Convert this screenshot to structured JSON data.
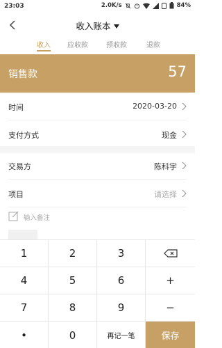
{
  "status_bar": {
    "time": "23:03",
    "speed": "2.0K/s",
    "battery": "84%"
  },
  "header": {
    "title": "收入账本"
  },
  "tabs": [
    {
      "label": "收入",
      "active": true
    },
    {
      "label": "应收款",
      "active": false
    },
    {
      "label": "预收款",
      "active": false
    },
    {
      "label": "退款",
      "active": false
    }
  ],
  "banner": {
    "label": "销售款",
    "amount": "57"
  },
  "fields": {
    "time": {
      "label": "时间",
      "value": "2020-03-20"
    },
    "payment": {
      "label": "支付方式",
      "value": "现金"
    },
    "counterparty": {
      "label": "交易方",
      "value": "陈科宇"
    },
    "project": {
      "label": "项目",
      "placeholder": "请选择"
    }
  },
  "note": {
    "placeholder": "输入备注"
  },
  "keypad": {
    "keys": [
      "1",
      "2",
      "3",
      "4",
      "5",
      "6",
      "+",
      "7",
      "8",
      "9",
      "−",
      "•",
      "0"
    ],
    "remember_label": "再记一笔",
    "save_label": "保存"
  },
  "colors": {
    "accent": "#c6a064",
    "tab_active": "#c9a063"
  }
}
